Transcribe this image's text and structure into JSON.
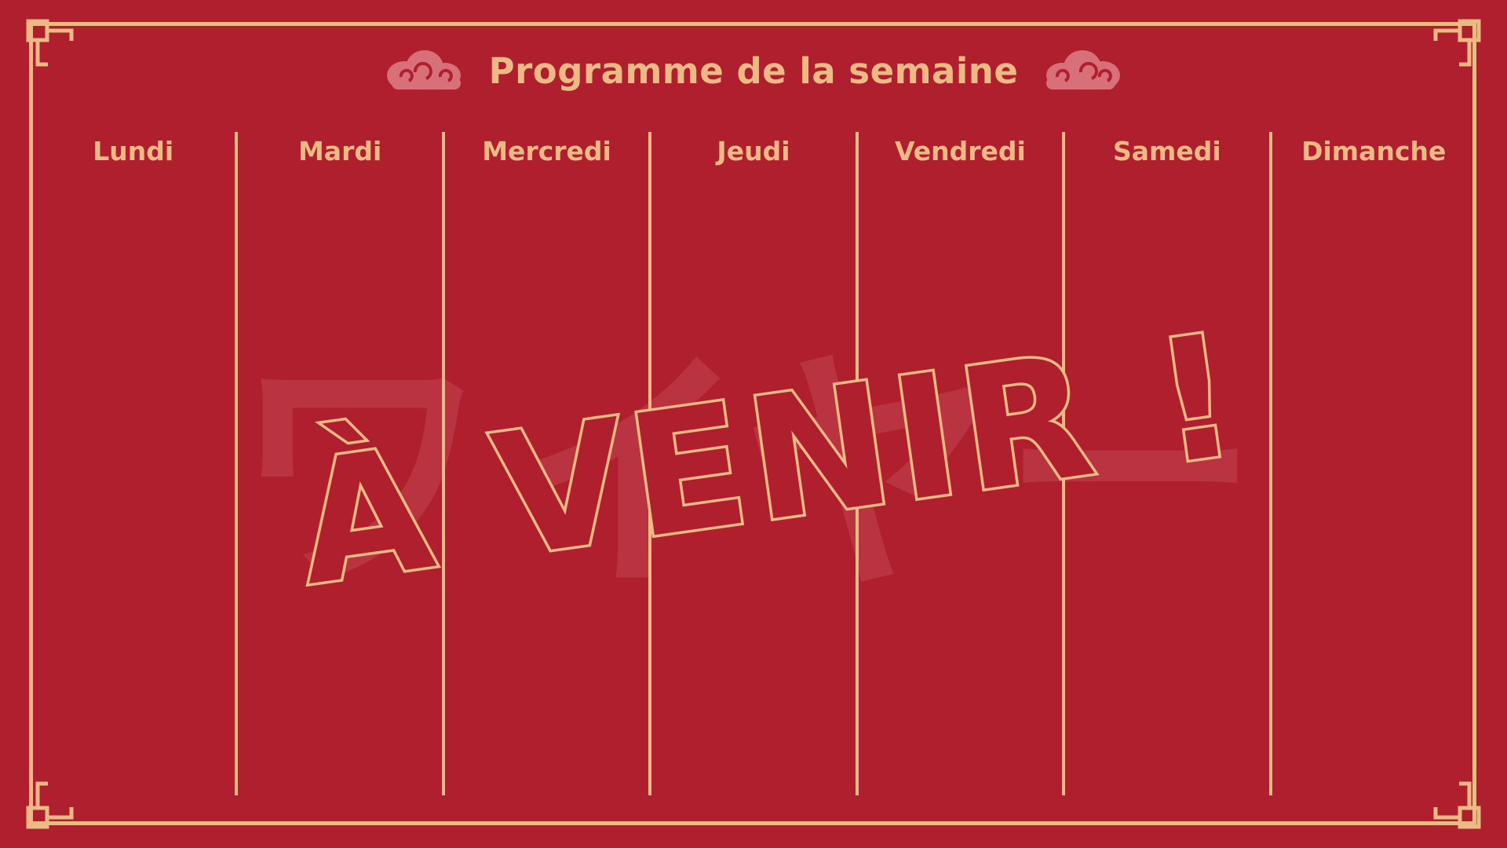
{
  "page_title": "Programme de la semaine",
  "days": [
    "Lundi",
    "Mardi",
    "Mercredi",
    "Jeudi",
    "Vendredi",
    "Samedi",
    "Dimanche"
  ],
  "stamp_text": "À VENIR !",
  "watermark_text": "ワイヤー",
  "colors": {
    "background": "#B01F2E",
    "accent": "#EDB984",
    "cloud": "#D8707A",
    "watermark": "#C24451"
  },
  "icons": [
    "cloud-icon",
    "cloud-icon",
    "corner-ornament-icon"
  ]
}
